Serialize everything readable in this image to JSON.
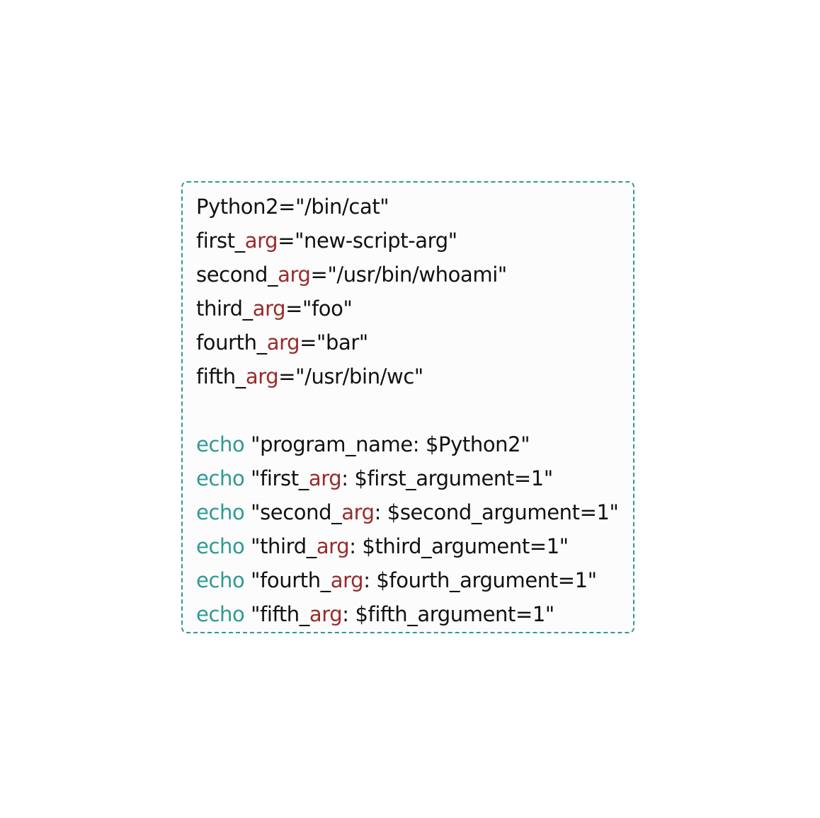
{
  "code": {
    "lines": [
      {
        "parts": [
          {
            "t": "Python2=\"/bin/cat\""
          }
        ]
      },
      {
        "parts": [
          {
            "t": "first_"
          },
          {
            "t": "arg",
            "c": "arg"
          },
          {
            "t": "=\"new-script-arg\""
          }
        ]
      },
      {
        "parts": [
          {
            "t": "second_"
          },
          {
            "t": "arg",
            "c": "arg"
          },
          {
            "t": "=\"/usr/bin/whoami\""
          }
        ]
      },
      {
        "parts": [
          {
            "t": "third_"
          },
          {
            "t": "arg",
            "c": "arg"
          },
          {
            "t": "=\"foo\""
          }
        ]
      },
      {
        "parts": [
          {
            "t": "fourth_"
          },
          {
            "t": "arg",
            "c": "arg"
          },
          {
            "t": "=\"bar\""
          }
        ]
      },
      {
        "parts": [
          {
            "t": "fifth_"
          },
          {
            "t": "arg",
            "c": "arg"
          },
          {
            "t": "=\"/usr/bin/wc\""
          }
        ]
      },
      {
        "parts": [
          {
            "t": ""
          }
        ]
      },
      {
        "parts": [
          {
            "t": "echo",
            "c": "kw"
          },
          {
            "t": " \"program_name: $Python2\""
          }
        ]
      },
      {
        "parts": [
          {
            "t": "echo",
            "c": "kw"
          },
          {
            "t": " \"first_"
          },
          {
            "t": "arg",
            "c": "arg"
          },
          {
            "t": ": $first_argument=1\""
          }
        ]
      },
      {
        "parts": [
          {
            "t": "echo",
            "c": "kw"
          },
          {
            "t": " \"second_"
          },
          {
            "t": "arg",
            "c": "arg"
          },
          {
            "t": ": $second_argument=1\""
          }
        ]
      },
      {
        "parts": [
          {
            "t": "echo",
            "c": "kw"
          },
          {
            "t": " \"third_"
          },
          {
            "t": "arg",
            "c": "arg"
          },
          {
            "t": ": $third_argument=1\""
          }
        ]
      },
      {
        "parts": [
          {
            "t": "echo",
            "c": "kw"
          },
          {
            "t": " \"fourth_"
          },
          {
            "t": "arg",
            "c": "arg"
          },
          {
            "t": ": $fourth_argument=1\""
          }
        ]
      },
      {
        "parts": [
          {
            "t": "echo",
            "c": "kw"
          },
          {
            "t": " \"fifth_"
          },
          {
            "t": "arg",
            "c": "arg"
          },
          {
            "t": ": $fifth_argument=1\""
          }
        ]
      }
    ]
  },
  "colors": {
    "border": "#2e9a93",
    "keyword": "#2e9a93",
    "arg": "#9a2a2a",
    "text": "#111111",
    "background": "#fcfcfc"
  }
}
